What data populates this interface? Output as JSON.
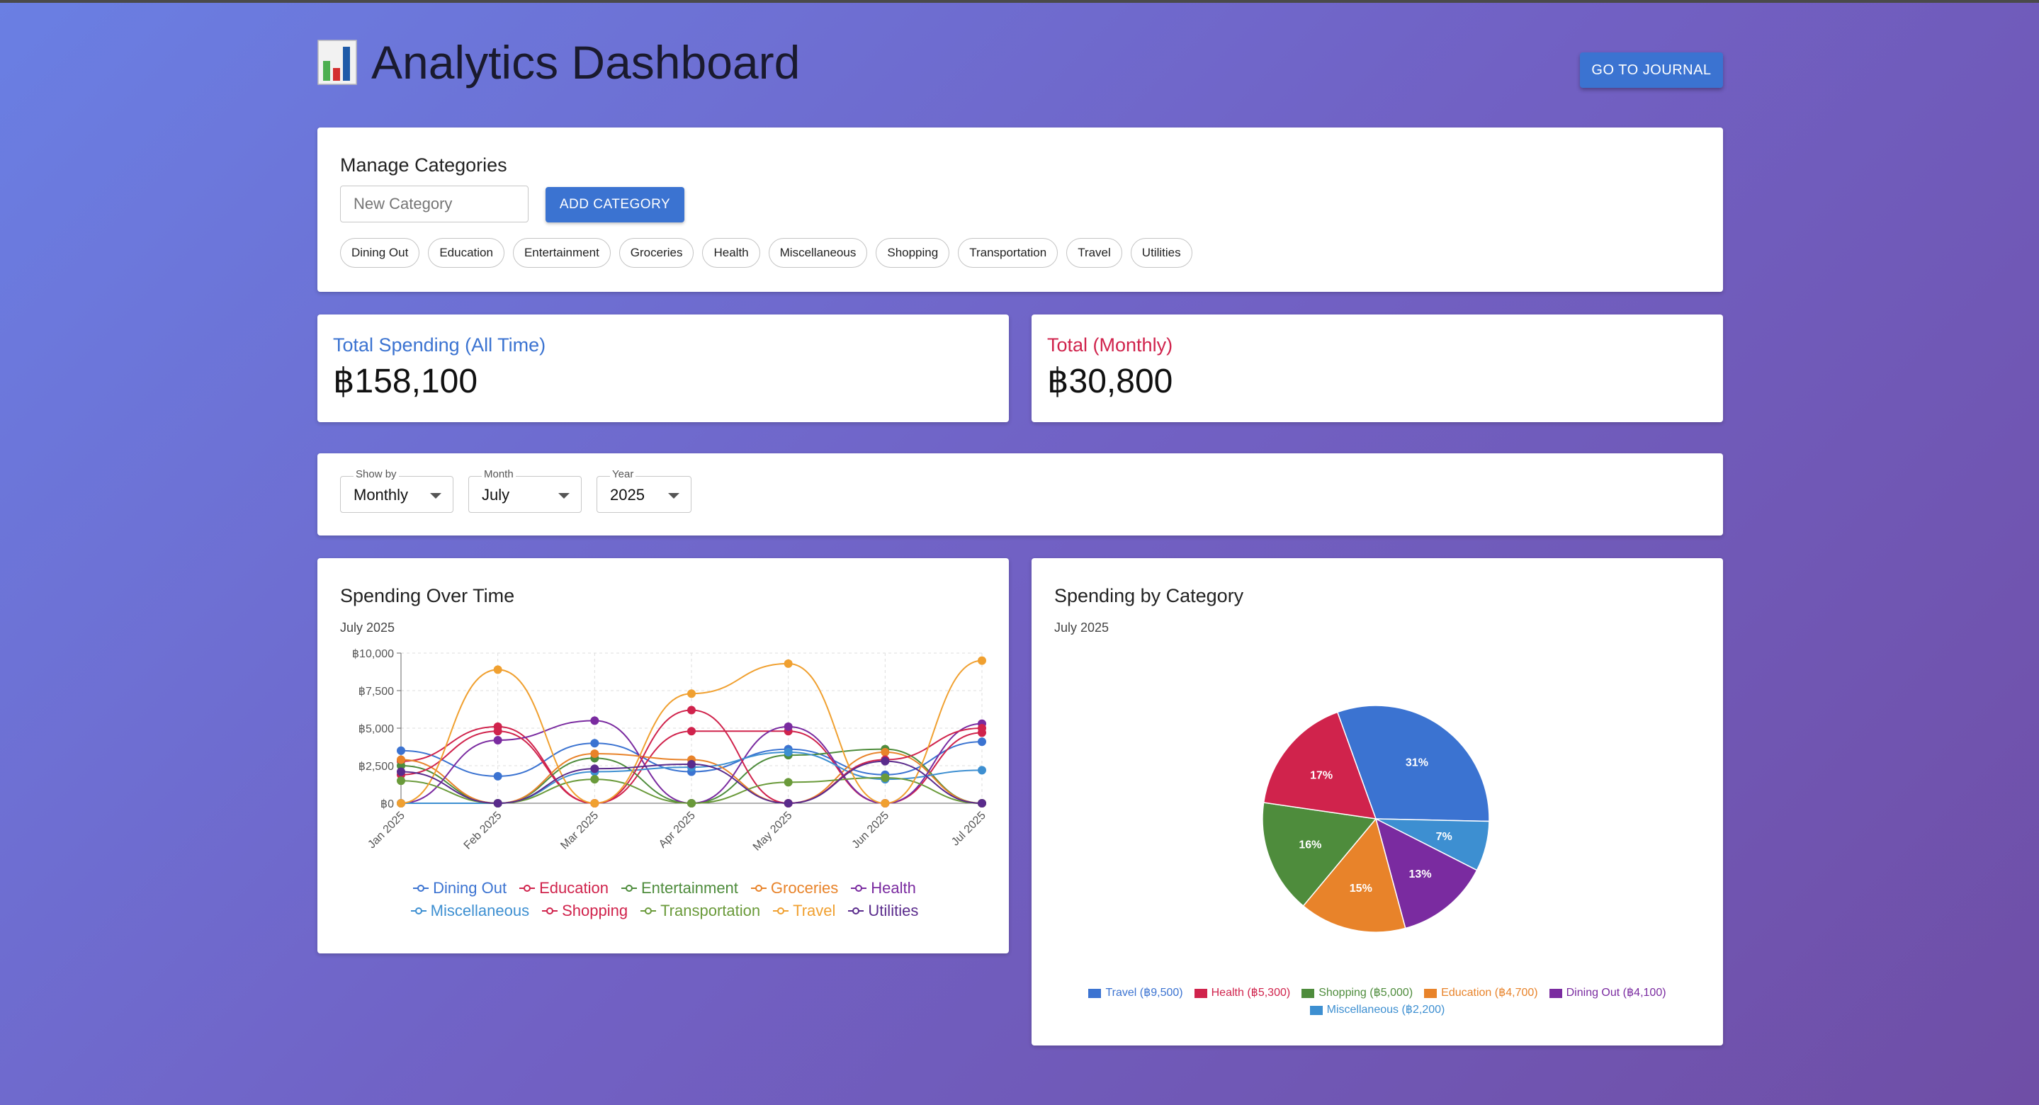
{
  "header": {
    "title": "Analytics Dashboard",
    "icon": "bar-chart-icon",
    "journal_button": "GO TO JOURNAL"
  },
  "categories_card": {
    "title": "Manage Categories",
    "input_placeholder": "New Category",
    "add_button": "ADD CATEGORY",
    "chips": [
      "Dining Out",
      "Education",
      "Entertainment",
      "Groceries",
      "Health",
      "Miscellaneous",
      "Shopping",
      "Transportation",
      "Travel",
      "Utilities"
    ]
  },
  "stats": {
    "all_time_label": "Total Spending (All Time)",
    "all_time_value": "฿158,100",
    "all_time_color": "#3b73d1",
    "monthly_label": "Total (Monthly)",
    "monthly_value": "฿30,800",
    "monthly_color": "#d0234c"
  },
  "filters": {
    "show_by": {
      "label": "Show by",
      "value": "Monthly"
    },
    "month": {
      "label": "Month",
      "value": "July"
    },
    "year": {
      "label": "Year",
      "value": "2025"
    }
  },
  "line_card": {
    "title": "Spending Over Time",
    "subtitle": "July 2025"
  },
  "pie_card": {
    "title": "Spending by Category",
    "subtitle": "July 2025"
  },
  "chart_data": [
    {
      "type": "line",
      "title": "Spending Over Time",
      "subtitle": "July 2025",
      "x": [
        "Jan 2025",
        "Feb 2025",
        "Mar 2025",
        "Apr 2025",
        "May 2025",
        "Jun 2025",
        "Jul 2025"
      ],
      "ylim": [
        0,
        10000
      ],
      "yticks": [
        "฿0",
        "฿2,500",
        "฿5,000",
        "฿7,500",
        "฿10,000"
      ],
      "grid": true,
      "legend_position": "bottom",
      "series": [
        {
          "name": "Dining Out",
          "color": "#3b73d1",
          "values": [
            3500,
            1800,
            4000,
            2100,
            3600,
            1900,
            4100
          ]
        },
        {
          "name": "Education",
          "color": "#d0234c",
          "values": [
            2800,
            5100,
            0,
            4800,
            4800,
            0,
            4700
          ]
        },
        {
          "name": "Entertainment",
          "color": "#4e8c3c",
          "values": [
            2500,
            0,
            3000,
            0,
            3200,
            3600,
            0
          ]
        },
        {
          "name": "Groceries",
          "color": "#e8832a",
          "values": [
            2900,
            0,
            3300,
            2900,
            0,
            3400,
            0
          ]
        },
        {
          "name": "Health",
          "color": "#7a2ba0",
          "values": [
            0,
            4200,
            5500,
            0,
            5100,
            0,
            5300
          ]
        },
        {
          "name": "Miscellaneous",
          "color": "#3d8fd1",
          "values": [
            0,
            0,
            2100,
            2400,
            3400,
            1600,
            2200
          ]
        },
        {
          "name": "Shopping",
          "color": "#d0234c",
          "values": [
            1900,
            4800,
            0,
            6200,
            0,
            2900,
            5000
          ]
        },
        {
          "name": "Transportation",
          "color": "#6a9a3a",
          "values": [
            1500,
            0,
            1600,
            0,
            1400,
            1700,
            0
          ]
        },
        {
          "name": "Travel",
          "color": "#f0a030",
          "values": [
            0,
            8900,
            0,
            7300,
            9300,
            0,
            9500
          ]
        },
        {
          "name": "Utilities",
          "color": "#5a2b8c",
          "values": [
            2100,
            0,
            2300,
            2600,
            0,
            2800,
            0
          ]
        }
      ]
    },
    {
      "type": "pie",
      "title": "Spending by Category",
      "subtitle": "July 2025",
      "legend_position": "bottom",
      "slices": [
        {
          "label": "Travel (฿9,500)",
          "value": 9500,
          "pct": "31%",
          "color": "#3b73d1"
        },
        {
          "label": "Miscellaneous (฿2,200)",
          "value": 2200,
          "pct": "7%",
          "color": "#3d8fd1"
        },
        {
          "label": "Dining Out (฿4,100)",
          "value": 4100,
          "pct": "13%",
          "color": "#7a2ba0"
        },
        {
          "label": "Education (฿4,700)",
          "value": 4700,
          "pct": "15%",
          "color": "#e8832a"
        },
        {
          "label": "Shopping (฿5,000)",
          "value": 5000,
          "pct": "16%",
          "color": "#4e8c3c"
        },
        {
          "label": "Health (฿5,300)",
          "value": 5300,
          "pct": "17%",
          "color": "#d0234c"
        }
      ],
      "legend_order": [
        "Travel (฿9,500)",
        "Health (฿5,300)",
        "Shopping (฿5,000)",
        "Education (฿4,700)",
        "Dining Out (฿4,100)",
        "Miscellaneous (฿2,200)"
      ]
    }
  ]
}
